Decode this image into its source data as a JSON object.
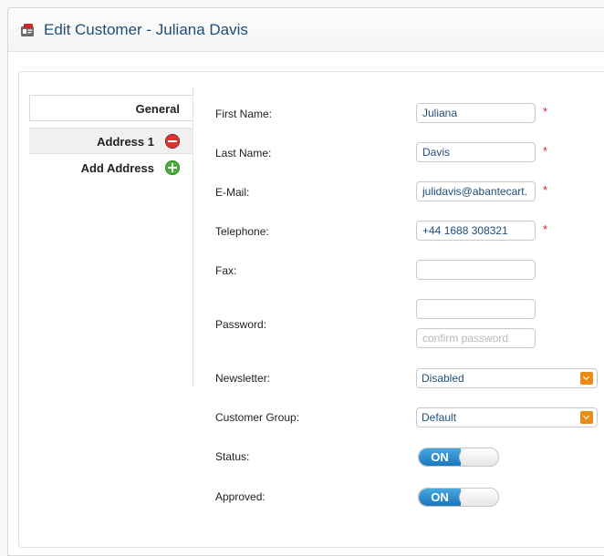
{
  "header": {
    "title": "Edit Customer - Juliana Davis",
    "icon": "customer-card-icon"
  },
  "sidebar": {
    "general": "General",
    "addresses": [
      {
        "label": "Address 1",
        "icon": "remove-icon"
      }
    ],
    "add_address": {
      "label": "Add Address",
      "icon": "add-icon"
    }
  },
  "form": {
    "first_name": {
      "label": "First Name:",
      "value": "Juliana",
      "required": "*"
    },
    "last_name": {
      "label": "Last Name:",
      "value": "Davis",
      "required": "*"
    },
    "email": {
      "label": "E-Mail:",
      "value": "julidavis@abantecart.",
      "required": "*"
    },
    "telephone": {
      "label": "Telephone:",
      "value": "+44 1688 308321",
      "required": "*"
    },
    "fax": {
      "label": "Fax:",
      "value": ""
    },
    "password": {
      "label": "Password:",
      "value": "",
      "confirm_placeholder": "confirm password"
    },
    "newsletter": {
      "label": "Newsletter:",
      "selected": "Disabled"
    },
    "customer_group": {
      "label": "Customer Group:",
      "selected": "Default"
    },
    "status": {
      "label": "Status:",
      "toggle": "ON"
    },
    "approved": {
      "label": "Approved:",
      "toggle": "ON"
    }
  },
  "colors": {
    "title": "#1f4e79",
    "toggle_on": "#1a78bd",
    "select_arrow": "#e98b1b",
    "required": "#dd2222"
  }
}
